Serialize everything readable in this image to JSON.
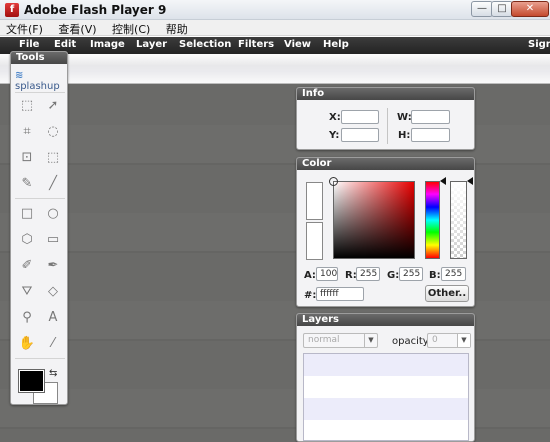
{
  "window": {
    "title": "Adobe Flash Player 9",
    "app_icon": "f"
  },
  "window_controls": {
    "minimize": "—",
    "maximize": "□",
    "close": "✕"
  },
  "os_menu": [
    "文件(F)",
    "查看(V)",
    "控制(C)",
    "帮助"
  ],
  "app_menu": [
    "File",
    "Edit",
    "Image",
    "Layer",
    "Selection",
    "Filters",
    "View",
    "Help",
    "Sign"
  ],
  "tools_panel": {
    "title": "Tools",
    "logo": "splashup",
    "tools": [
      {
        "name": "marquee-rect-icon",
        "glyph": "⬚"
      },
      {
        "name": "pointer-icon",
        "glyph": "➚"
      },
      {
        "name": "crop-icon",
        "glyph": "⌗"
      },
      {
        "name": "lasso-icon",
        "glyph": "◌"
      },
      {
        "name": "transform-icon",
        "glyph": "⊡"
      },
      {
        "name": "marquee-ellipse-icon",
        "glyph": "⬚"
      },
      {
        "name": "pencil-icon",
        "glyph": "✎"
      },
      {
        "name": "line-icon",
        "glyph": "╱"
      },
      {
        "name": "rect-shape-icon",
        "glyph": "□"
      },
      {
        "name": "ellipse-shape-icon",
        "glyph": "○"
      },
      {
        "name": "polygon-icon",
        "glyph": "⬡"
      },
      {
        "name": "rounded-rect-icon",
        "glyph": "▭"
      },
      {
        "name": "brush-icon",
        "glyph": "✐"
      },
      {
        "name": "smudge-icon",
        "glyph": "✒"
      },
      {
        "name": "fill-bucket-icon",
        "glyph": "⛛"
      },
      {
        "name": "eraser-icon",
        "glyph": "◇"
      },
      {
        "name": "dropper-icon",
        "glyph": "⚲"
      },
      {
        "name": "text-icon",
        "glyph": "A"
      },
      {
        "name": "hand-icon",
        "glyph": "✋"
      },
      {
        "name": "eyedropper-icon",
        "glyph": "⁄"
      }
    ],
    "fg_color": "#000000",
    "bg_color": "#ffffff",
    "swap_icon": "⇆"
  },
  "info_panel": {
    "title": "Info",
    "x_label": "X:",
    "y_label": "Y:",
    "w_label": "W:",
    "h_label": "H:",
    "x_value": "",
    "y_value": "",
    "w_value": "",
    "h_value": ""
  },
  "color_panel": {
    "title": "Color",
    "a_label": "A:",
    "a_value": "100",
    "r_label": "R:",
    "r_value": "255",
    "g_label": "G:",
    "g_value": "255",
    "b_label": "B:",
    "b_value": "255",
    "hex_label": "#:",
    "hex_value": "ffffff",
    "other_button": "Other.."
  },
  "layers_panel": {
    "title": "Layers",
    "blend_mode": "normal",
    "opacity_label": "opacity:",
    "opacity_value": "0"
  }
}
